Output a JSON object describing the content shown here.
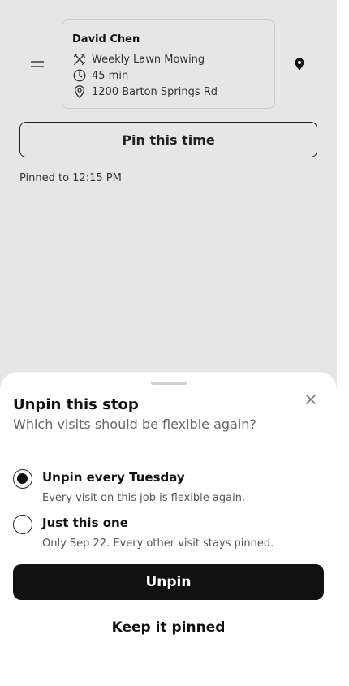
{
  "job": {
    "customer": "David Chen",
    "service": "Weekly Lawn Mowing",
    "duration": "45 min",
    "address": "1200 Barton Springs Rd",
    "service_icon": "tools-icon",
    "duration_icon": "clock-icon",
    "address_icon": "location-pin-icon"
  },
  "actions": {
    "pin_time_label": "Pin this time",
    "pinned_note": "Pinned to 12:15 PM"
  },
  "sheet": {
    "title": "Unpin this stop",
    "subtitle": "Which visits should be flexible again?",
    "options": [
      {
        "label": "Unpin every Tuesday",
        "description": "Every visit on this job is flexible again.",
        "selected": true
      },
      {
        "label": "Just this one",
        "description": "Only Sep 22. Every other visit stays pinned.",
        "selected": false
      }
    ],
    "primary_label": "Unpin",
    "secondary_label": "Keep it pinned"
  },
  "colors": {
    "backdrop": "#e6e6e6",
    "primary_button": "#111111",
    "text_secondary": "#666666"
  }
}
